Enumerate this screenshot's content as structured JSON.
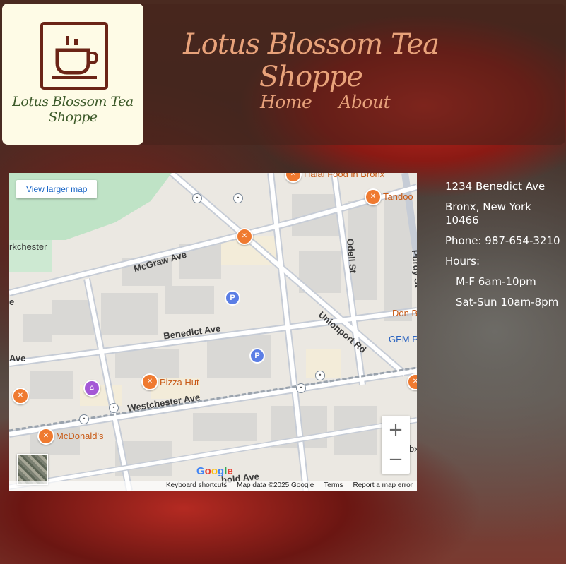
{
  "brand": {
    "logo_text": "Lotus Blossom Tea Shoppe",
    "icon": "teacup-icon",
    "colors": {
      "accent": "#e8a27a",
      "logo_green": "#3d5a2a",
      "logo_bg": "#fefbe6",
      "icon_brown": "#6b2416"
    }
  },
  "header": {
    "title": "Lotus Blossom Tea Shoppe"
  },
  "nav": {
    "items": [
      {
        "label": "Home"
      },
      {
        "label": "About"
      }
    ]
  },
  "map": {
    "larger_map_label": "View larger map",
    "streets": {
      "mcgraw": "McGraw Ave",
      "benedict": "Benedict Ave",
      "westchester": "Westchester Ave",
      "unionport": "Unionport Rd",
      "odell": "Odell St",
      "purdy": "Purdy St",
      "ave_left": "Ave",
      "e_left": "e",
      "bottom": "hold Ave"
    },
    "areas": {
      "parkchester": "rkchester"
    },
    "pois": {
      "halal": "Halal Food in Bronx",
      "tandoor": "Tandoo",
      "pizza": "Pizza Hut",
      "mcdonalds": "McDonald's",
      "don": "Don B",
      "gem": "GEM P",
      "bx": "bx"
    },
    "zoom_in": "+",
    "zoom_out": "−",
    "google_logo": "Google",
    "footer": {
      "shortcuts": "Keyboard shortcuts",
      "data": "Map data ©2025 Google",
      "terms": "Terms",
      "report": "Report a map error"
    }
  },
  "info": {
    "street": "1234 Benedict Ave",
    "city": "Bronx, New York 10466",
    "phone": "Phone: 987-654-3210",
    "hours_label": "Hours:",
    "hours_weekday": "M-F 6am-10pm",
    "hours_weekend": "Sat-Sun 10am-8pm"
  }
}
